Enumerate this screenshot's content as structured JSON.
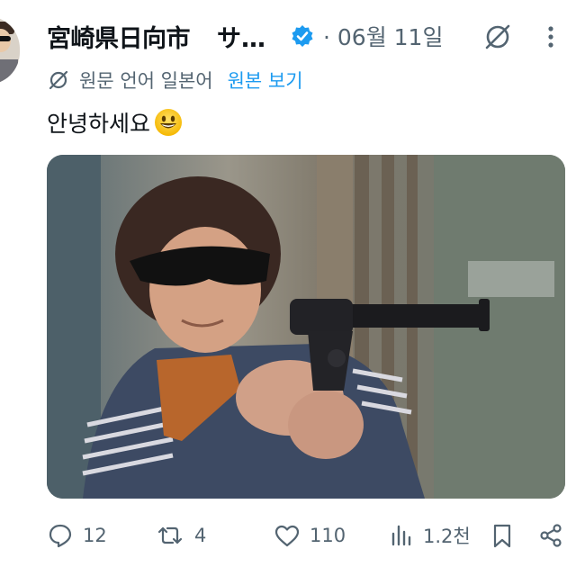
{
  "post": {
    "author_name": "宮崎県日向市",
    "author_name_trunc": "サ…",
    "date": "· 06월 11일",
    "translate_label": "원문 언어 일본어",
    "translate_link": "원본 보기",
    "text": "안녕하세요"
  },
  "actions": {
    "replies": "12",
    "reposts": "4",
    "likes": "110",
    "views": "1.2천"
  },
  "icons": [
    "avatar",
    "verified-badge-icon",
    "grok-icon",
    "more-icon",
    "translate-icon",
    "smiley-emoji",
    "reply-icon",
    "repost-icon",
    "like-icon",
    "views-icon",
    "bookmark-icon",
    "share-icon"
  ],
  "colors": {
    "accent": "#1d9bf0",
    "text": "#0f1419",
    "muted": "#536471"
  }
}
